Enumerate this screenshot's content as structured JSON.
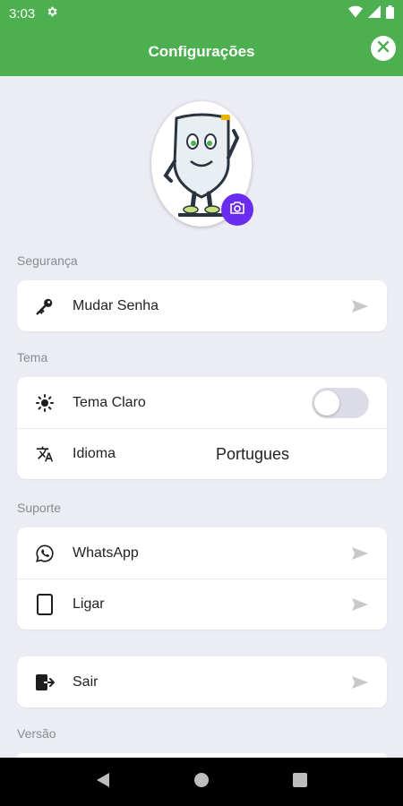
{
  "status_bar": {
    "time": "3:03"
  },
  "app_bar": {
    "title": "Configurações"
  },
  "sections": {
    "security": {
      "title": "Segurança",
      "change_password": "Mudar Senha"
    },
    "theme": {
      "title": "Tema",
      "light_theme": "Tema Claro",
      "language": "Idioma",
      "language_value": "Portugues"
    },
    "support": {
      "title": "Suporte",
      "whatsapp": "WhatsApp",
      "call": "Ligar"
    },
    "logout": {
      "label": "Sair"
    },
    "version": {
      "title": "Versão"
    }
  },
  "colors": {
    "primary": "#4caf50",
    "accent": "#6a2cf0",
    "background": "#ececf4"
  },
  "icons": [
    "settings-icon",
    "wifi-icon",
    "signal-icon",
    "battery-icon",
    "close-icon",
    "camera-icon",
    "key-icon",
    "sun-icon",
    "translate-icon",
    "whatsapp-icon",
    "tablet-icon",
    "logout-icon",
    "send-arrow-icon"
  ],
  "toggle_light_theme_on": false
}
